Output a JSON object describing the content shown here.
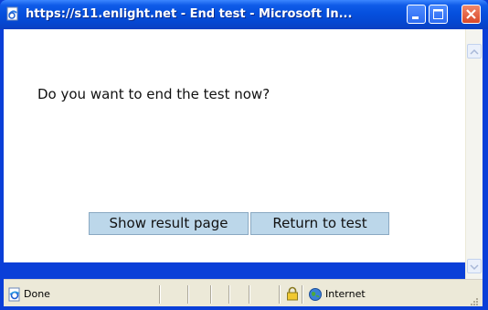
{
  "window": {
    "title": "https://s11.enlight.net - End test - Microsoft In...",
    "title_icon": "ie-page-icon",
    "controls": [
      "minimize",
      "maximize",
      "close"
    ]
  },
  "dialog": {
    "prompt": "Do you want to end the test now?",
    "show_result_label": "Show result page",
    "return_label": "Return to test"
  },
  "statusbar": {
    "status_text": "Done",
    "zone_text": "Internet"
  },
  "colors": {
    "titlebar": "#0550de",
    "button_bg": "#bcd7ea",
    "statusbar_bg": "#ece9d8",
    "close_button": "#d9482a"
  }
}
